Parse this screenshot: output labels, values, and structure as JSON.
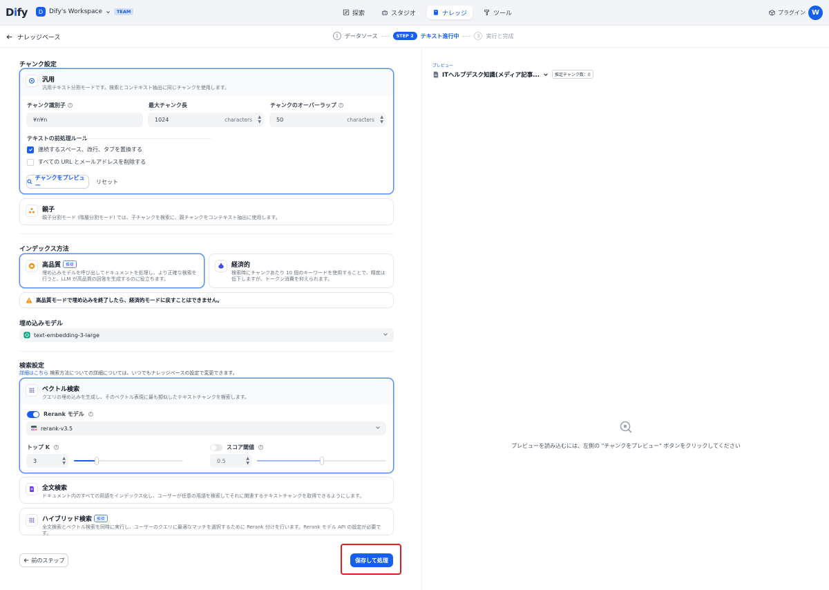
{
  "header": {
    "logo_d": "D",
    "logo_i": "i",
    "logo_fy": "fy",
    "workspace_initial": "D",
    "workspace_name": "Dify's Workspace",
    "team_badge": "TEAM",
    "nav": [
      {
        "label": "探索",
        "icon": "compass-icon"
      },
      {
        "label": "スタジオ",
        "icon": "robot-icon"
      },
      {
        "label": "ナレッジ",
        "icon": "book-icon"
      },
      {
        "label": "ツール",
        "icon": "hammer-icon"
      }
    ],
    "plugin_label": "プラグイン",
    "user_initial": "W"
  },
  "subheader": {
    "back_label": "ナレッジベース",
    "steps": [
      {
        "num": "1",
        "label": "データソース"
      },
      {
        "badge": "STEP 2",
        "label": "テキスト進行中"
      },
      {
        "num": "3",
        "label": "実行と完成"
      }
    ]
  },
  "chunk": {
    "section_title": "チャンク設定",
    "general": {
      "title": "汎用",
      "desc": "汎用テキスト分割モードです。検索とコンテキスト抽出に同じチャンクを使用します。",
      "delimiter_label": "チャンク識別子",
      "delimiter_value": "¥n¥n",
      "max_len_label": "最大チャンク長",
      "max_len_value": "1024",
      "max_len_unit": "characters",
      "overlap_label": "チャンクのオーバーラップ",
      "overlap_value": "50",
      "overlap_unit": "characters",
      "rules_title": "テキストの前処理ルール",
      "rule1": "連続するスペース、改行、タブを置換する",
      "rule1_checked": true,
      "rule2": "すべての URL とメールアドレスを削除する",
      "rule2_checked": false,
      "preview_btn": "チャンクをプレビュー",
      "reset_btn": "リセット"
    },
    "parent": {
      "title": "親子",
      "desc": "親子分割モード (階層分割モード) では、子チャンクを検索に、親チャンクをコンテキスト抽出に使用します。"
    }
  },
  "index": {
    "section_title": "インデックス方法",
    "high": {
      "title": "高品質",
      "badge": "推奨",
      "desc": "埋め込みモデルを呼び出してドキュメントを処理し、より正確な検索を行うと、LLM が高品質の回答を生成するのに役立ちます。"
    },
    "economy": {
      "title": "経済的",
      "desc": "検索時にチャンクあたり 10 個のキーワードを使用することで、精度は低下しますが、トークン消費を抑えられます。"
    },
    "warning": "高品質モードで埋め込みを終了したら、経済的モードに戻すことはできません。"
  },
  "embedding": {
    "section_title": "埋め込みモデル",
    "model": "text-embedding-3-large"
  },
  "retrieval": {
    "section_title": "検索設定",
    "link_text": "詳細はこちら",
    "hint": " 検索方法についての詳細については、いつでもナレッジベースの設定で変更できます。",
    "vector": {
      "title": "ベクトル検索",
      "desc": "クエリの埋め込みを生成し、そのベクトル表現に最も類似したテキストチャンクを検索します。",
      "rerank_label": "Rerank モデル",
      "rerank_on": true,
      "rerank_model": "rerank-v3.5",
      "topk_label": "トップ K",
      "topk_value": "3",
      "topk_fraction": 0.21,
      "score_label": "スコア閾値",
      "score_on": false,
      "score_value": "0.5",
      "score_fraction": 0.5
    },
    "fulltext": {
      "title": "全文検索",
      "desc": "ドキュメント内のすべての用語をインデックス化し、ユーザーが任意の用語を検索してそれに関連するテキストチャンクを取得できるようにします。"
    },
    "hybrid": {
      "title": "ハイブリッド検索",
      "badge": "推奨",
      "desc": "全文検索とベクトル検索を同時に実行し、ユーザーのクエリに最適なマッチを選択するために Rerank 付けを行います。Rerank モデル API の設定が必要です。"
    }
  },
  "footer": {
    "prev_btn": "前のステップ",
    "save_btn": "保存して処理"
  },
  "preview": {
    "label": "プレビュー",
    "doc_name": "ITヘルプデスク知識(メディア記事...",
    "count_badge": "推定チャンク数：0",
    "empty_text": "プレビューを読み込むには、左側の \"チャンクをプレビュー\" ボタンをクリックしてください"
  },
  "colors": {
    "accent": "#155eef",
    "highlight": "#e11d1d",
    "warning": "#f79009"
  }
}
